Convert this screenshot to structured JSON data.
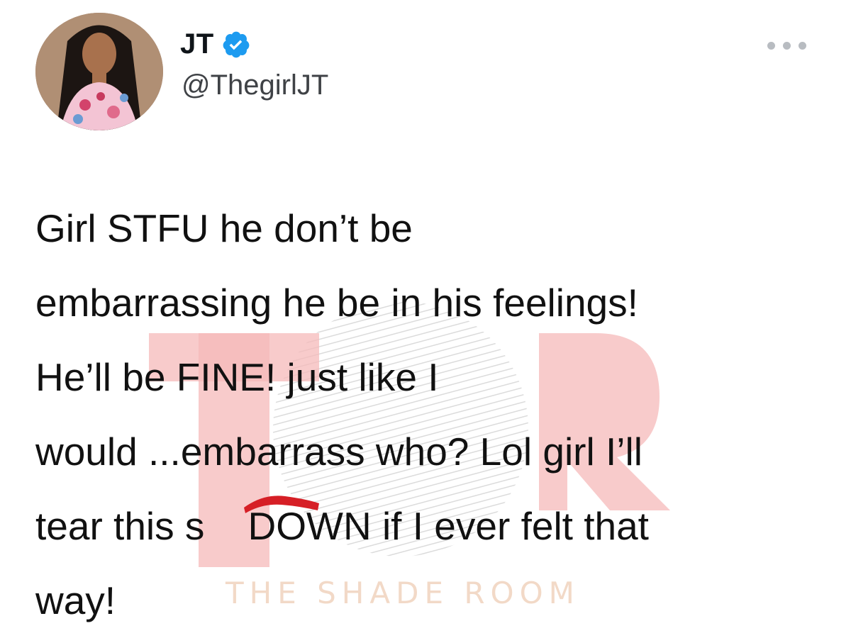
{
  "tweet": {
    "display_name": "JT",
    "handle": "@ThegirlJT",
    "verified_color": "#1d9bf0",
    "more_icon": "ellipsis-icon",
    "text_lines": [
      "Girl STFU he don’t be",
      "embarrassing he be in his feelings!",
      "He’ll be FINE! just like I",
      "would ...embarrass who? Lol girl I’ll",
      "tear this s    DOWN if I ever felt that",
      "way!"
    ]
  },
  "watermark": {
    "text": "THE SHADE ROOM",
    "logo_color": "#f6b9b9"
  },
  "redaction_color": "#d61f26"
}
